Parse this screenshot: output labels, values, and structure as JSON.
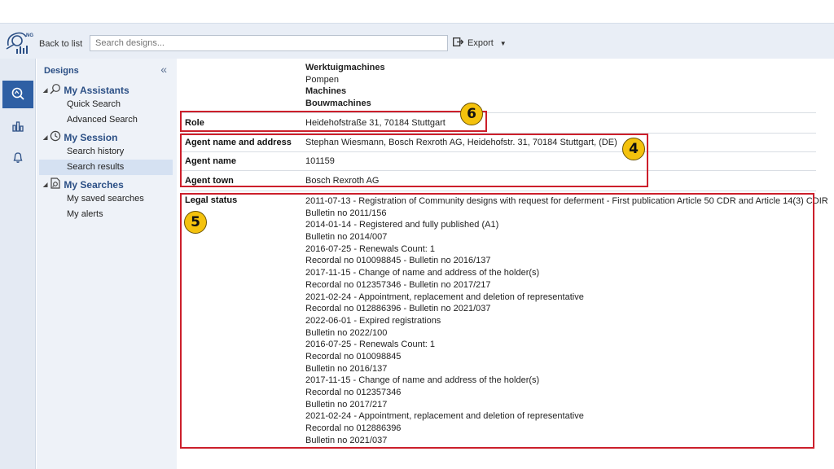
{
  "toolbar": {
    "back_label": "Back to list",
    "search_placeholder": "Search designs...",
    "export_label": "Export",
    "logo_badge": "NG"
  },
  "sidebar": {
    "heading": "Designs",
    "collapse_glyph": "«",
    "groups": [
      {
        "label": "My Assistants",
        "icon": "search-icon",
        "items": [
          "Quick Search",
          "Advanced Search"
        ]
      },
      {
        "label": "My Session",
        "icon": "clock-icon",
        "items": [
          "Search history",
          "Search results"
        ]
      },
      {
        "label": "My Searches",
        "icon": "saved-search-icon",
        "items": [
          "My saved searches",
          "My alerts"
        ]
      }
    ],
    "selected_item": "Search results"
  },
  "rail_icons": [
    "design-search-icon",
    "chart-icon",
    "bell-icon"
  ],
  "details": {
    "classification_values": [
      {
        "text": "Werktuigmachines",
        "bold": true
      },
      {
        "text": "Pompen",
        "bold": false
      },
      {
        "text": "Machines",
        "bold": true
      },
      {
        "text": "Bouwmachines",
        "bold": true
      }
    ],
    "role": {
      "label": "Role",
      "value": "Heidehofstraße 31, 70184 Stuttgart"
    },
    "agent_name_address": {
      "label": "Agent name and address",
      "value": "Stephan Wiesmann, Bosch Rexroth AG, Heidehofstr. 31, 70184 Stuttgart, (DE)"
    },
    "agent_name": {
      "label": "Agent name",
      "value": "101159"
    },
    "agent_town": {
      "label": "Agent town",
      "value": "Bosch Rexroth AG"
    },
    "legal_status": {
      "label": "Legal status",
      "entries": [
        "2011-07-13 - Registration of Community designs with request for deferment - First publication Article 50 CDR and Article 14(3) CDIR",
        "Bulletin no 2011/156",
        "2014-01-14 - Registered and fully published (A1)",
        "Bulletin no 2014/007",
        "2016-07-25 - Renewals Count: 1",
        "Recordal no 010098845 - Bulletin no 2016/137",
        "2017-11-15 - Change of name and address of the holder(s)",
        "Recordal no 012357346 - Bulletin no 2017/217",
        "2021-02-24 - Appointment, replacement and deletion of representative",
        "Recordal no 012886396 - Bulletin no 2021/037",
        "2022-06-01 - Expired registrations",
        "Bulletin no 2022/100",
        "2016-07-25 - Renewals Count: 1",
        "Recordal no 010098845",
        "Bulletin no 2016/137",
        "2017-11-15 - Change of name and address of the holder(s)",
        "Recordal no 012357346",
        "Bulletin no 2017/217",
        "2021-02-24 - Appointment, replacement and deletion of representative",
        "Recordal no 012886396",
        "Bulletin no 2021/037"
      ]
    }
  },
  "callouts": {
    "role": "6",
    "agent": "4",
    "legal": "5"
  },
  "colors": {
    "highlight_border": "#cc1f2b",
    "callout_fill": "#f4c20d",
    "rail_active": "#2e5fa4",
    "link": "#2b4f85"
  }
}
